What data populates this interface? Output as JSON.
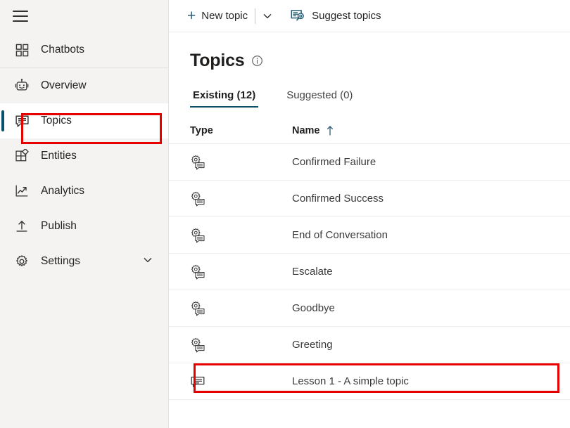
{
  "sidebar": {
    "menu_icon": "hamburger-menu-icon",
    "items": [
      {
        "id": "chatbots",
        "label": "Chatbots",
        "icon": "grid-icon",
        "selected": false
      },
      {
        "id": "overview",
        "label": "Overview",
        "icon": "robot-icon",
        "selected": false
      },
      {
        "id": "topics",
        "label": "Topics",
        "icon": "speech-bubble-icon",
        "selected": true
      },
      {
        "id": "entities",
        "label": "Entities",
        "icon": "entities-grid-icon",
        "selected": false
      },
      {
        "id": "analytics",
        "label": "Analytics",
        "icon": "line-chart-icon",
        "selected": false
      },
      {
        "id": "publish",
        "label": "Publish",
        "icon": "upload-icon",
        "selected": false
      },
      {
        "id": "settings",
        "label": "Settings",
        "icon": "gear-icon",
        "selected": false,
        "expandable": true
      }
    ]
  },
  "toolbar": {
    "new_topic_label": "New topic",
    "new_topic_caret": "chevron-down-icon",
    "suggest_topics_label": "Suggest topics",
    "suggest_topics_icon": "suggest-topics-icon"
  },
  "page": {
    "title": "Topics",
    "info_icon": "info-icon"
  },
  "tabs": [
    {
      "id": "existing",
      "label": "Existing (12)",
      "active": true
    },
    {
      "id": "suggested",
      "label": "Suggested (0)",
      "active": false
    }
  ],
  "table": {
    "headers": {
      "type": "Type",
      "name": "Name"
    },
    "sort": {
      "column": "Name",
      "direction": "ascending",
      "icon": "arrow-up-icon"
    },
    "rows": [
      {
        "type_icon": "system-topic-icon",
        "name": "Confirmed Failure"
      },
      {
        "type_icon": "system-topic-icon",
        "name": "Confirmed Success"
      },
      {
        "type_icon": "system-topic-icon",
        "name": "End of Conversation"
      },
      {
        "type_icon": "system-topic-icon",
        "name": "Escalate"
      },
      {
        "type_icon": "system-topic-icon",
        "name": "Goodbye"
      },
      {
        "type_icon": "system-topic-icon",
        "name": "Greeting"
      },
      {
        "type_icon": "user-topic-icon",
        "name": "Lesson 1 - A simple topic"
      }
    ]
  },
  "annotations": [
    {
      "id": "sidebar-topics-highlight",
      "target": "Topics",
      "color": "#e60000"
    },
    {
      "id": "greeting-row-highlight",
      "target": "Greeting",
      "color": "#e60000"
    }
  ],
  "colors": {
    "accent": "#0b5069",
    "sidebar_bg": "#f4f3f2",
    "annotation": "#e60000"
  }
}
